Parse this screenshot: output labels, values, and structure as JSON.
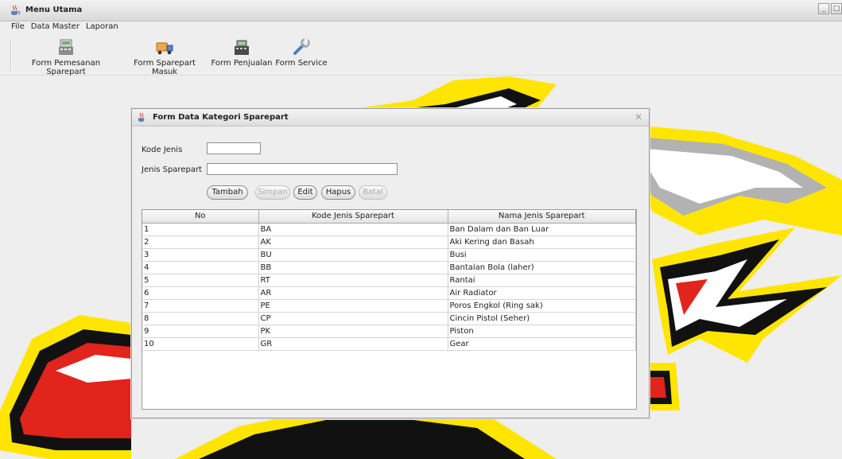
{
  "window": {
    "title": "Menu Utama"
  },
  "menubar": {
    "items": [
      "File",
      "Data Master",
      "Laporan"
    ]
  },
  "toolbar": {
    "buttons": [
      {
        "label": "Form Pemesanan Sparepart",
        "icon": "cash-register-icon"
      },
      {
        "label": "Form Sparepart Masuk",
        "icon": "delivery-truck-icon"
      },
      {
        "label": "Form Penjualan",
        "icon": "cash-register-icon"
      },
      {
        "label": "Form Service",
        "icon": "wrench-icon"
      }
    ]
  },
  "dialog": {
    "title": "Form Data Kategori Sparepart",
    "fields": {
      "kode_jenis_label": "Kode Jenis",
      "kode_jenis_value": "",
      "jenis_sparepart_label": "Jenis Sparepart",
      "jenis_sparepart_value": ""
    },
    "buttons": {
      "tambah": "Tambah",
      "simpan": "Simpan",
      "edit": "Edit",
      "hapus": "Hapus",
      "batal": "Batal"
    },
    "table": {
      "columns": [
        "No",
        "Kode Jenis Sparepart",
        "Nama Jenis Sparepart"
      ],
      "rows": [
        [
          "1",
          "BA",
          "Ban Dalam dan Ban Luar"
        ],
        [
          "2",
          "AK",
          "Aki Kering dan Basah"
        ],
        [
          "3",
          "BU",
          "Busi"
        ],
        [
          "4",
          "BB",
          "Bantalan Bola (laher)"
        ],
        [
          "5",
          "RT",
          "Rantai"
        ],
        [
          "6",
          "AR",
          "Air Radiator"
        ],
        [
          "7",
          "PE",
          "Poros Engkol (Ring sak)"
        ],
        [
          "8",
          "CP",
          "Cincin Pistol (Seher)"
        ],
        [
          "9",
          "PK",
          "Piston"
        ],
        [
          "10",
          "GR",
          "Gear"
        ]
      ]
    }
  },
  "colors": {
    "logo_red": "#e1241c",
    "logo_yellow": "#ffe500",
    "logo_black": "#111111",
    "logo_gray": "#a7a7a7"
  }
}
